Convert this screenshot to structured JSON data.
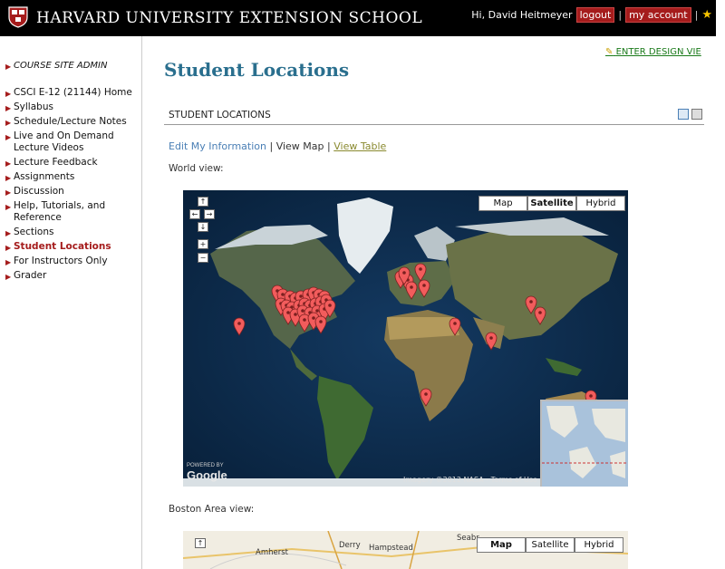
{
  "header": {
    "school_title": "HARVARD UNIVERSITY EXTENSION SCHOOL",
    "greeting": "Hi, David Heitmeyer",
    "logout_label": "logout",
    "account_label": "my account",
    "separator": "|",
    "star_icon": "★",
    "brand_color": "#a51c1c"
  },
  "sidebar": {
    "admin_label": "COURSE SITE ADMIN",
    "items": [
      {
        "label": "CSCI E-12 (21144) Home"
      },
      {
        "label": "Syllabus"
      },
      {
        "label": "Schedule/Lecture Notes"
      },
      {
        "label": "Live and On Demand Lecture Videos"
      },
      {
        "label": "Lecture Feedback"
      },
      {
        "label": "Assignments"
      },
      {
        "label": "Discussion"
      },
      {
        "label": "Help, Tutorials, and Reference"
      },
      {
        "label": "Sections"
      },
      {
        "label": "Student Locations"
      },
      {
        "label": "For Instructors Only"
      },
      {
        "label": "Grader"
      }
    ]
  },
  "main": {
    "design_link": "ENTER DESIGN VIE",
    "page_title": "Student Locations",
    "section_title": "STUDENT LOCATIONS",
    "edit_link": "Edit My Information",
    "view_map": "View Map",
    "view_table": "View Table",
    "link_sep": "|",
    "world_label": "World view:",
    "boston_label": "Boston Area view:"
  },
  "world_map": {
    "types": [
      "Map",
      "Satellite",
      "Hybrid"
    ],
    "selected_type": "Satellite",
    "logo": "Google",
    "powered": "POWERED BY",
    "imagery": "Imagery ©2012 NASA - Terms of Use",
    "nav_up": "↑",
    "nav_left": "←",
    "nav_right": "→",
    "nav_down": "↓",
    "zoom_in": "+",
    "zoom_out": "−",
    "ocean_color": "#0c2640",
    "marker_color": "#f25c5c"
  },
  "boston_map": {
    "types": [
      "Map",
      "Satellite",
      "Hybrid"
    ],
    "selected_type": "Map",
    "towns": [
      "Derry",
      "Amherst",
      "Hampstead",
      "Seabr"
    ]
  }
}
